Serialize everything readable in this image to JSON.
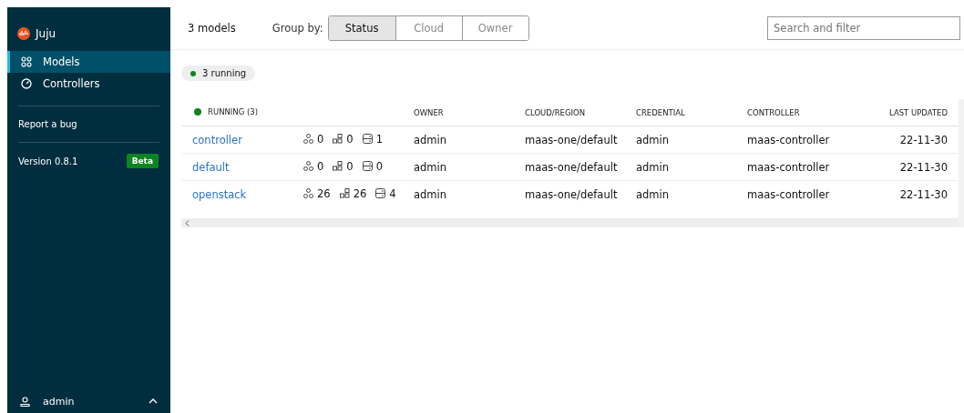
{
  "app": {
    "name": "Juju"
  },
  "sidebar": {
    "items": [
      {
        "label": "Models",
        "kind": "models",
        "selected": true
      },
      {
        "label": "Controllers",
        "kind": "controllers",
        "selected": false
      }
    ],
    "report_link": "Report a bug",
    "version": "Version 0.8.1",
    "badge": "Beta",
    "user": "admin"
  },
  "header": {
    "count": "3 models",
    "group_by_label": "Group by:",
    "group_by": [
      {
        "label": "Status",
        "selected": true
      },
      {
        "label": "Cloud",
        "selected": false
      },
      {
        "label": "Owner",
        "selected": false
      }
    ],
    "search": {
      "placeholder": "Search and filter"
    }
  },
  "status_chip": {
    "label": "3 running",
    "color": "#0e8420"
  },
  "table": {
    "group": {
      "label": "RUNNING (3)",
      "color": "#0e8420"
    },
    "columns": [
      "OWNER",
      "CLOUD/REGION",
      "CREDENTIAL",
      "CONTROLLER",
      "LAST UPDATED"
    ],
    "rows": [
      {
        "name": "controller",
        "apps": "0",
        "units": "0",
        "machines": "1",
        "owner": "admin",
        "cloud": "maas-one/default",
        "credential": "admin",
        "controller": "maas-controller",
        "updated": "22-11-30"
      },
      {
        "name": "default",
        "apps": "0",
        "units": "0",
        "machines": "0",
        "owner": "admin",
        "cloud": "maas-one/default",
        "credential": "admin",
        "controller": "maas-controller",
        "updated": "22-11-30"
      },
      {
        "name": "openstack",
        "apps": "26",
        "units": "26",
        "machines": "4",
        "owner": "admin",
        "cloud": "maas-one/default",
        "credential": "admin",
        "controller": "maas-controller",
        "updated": "22-11-30"
      }
    ]
  }
}
